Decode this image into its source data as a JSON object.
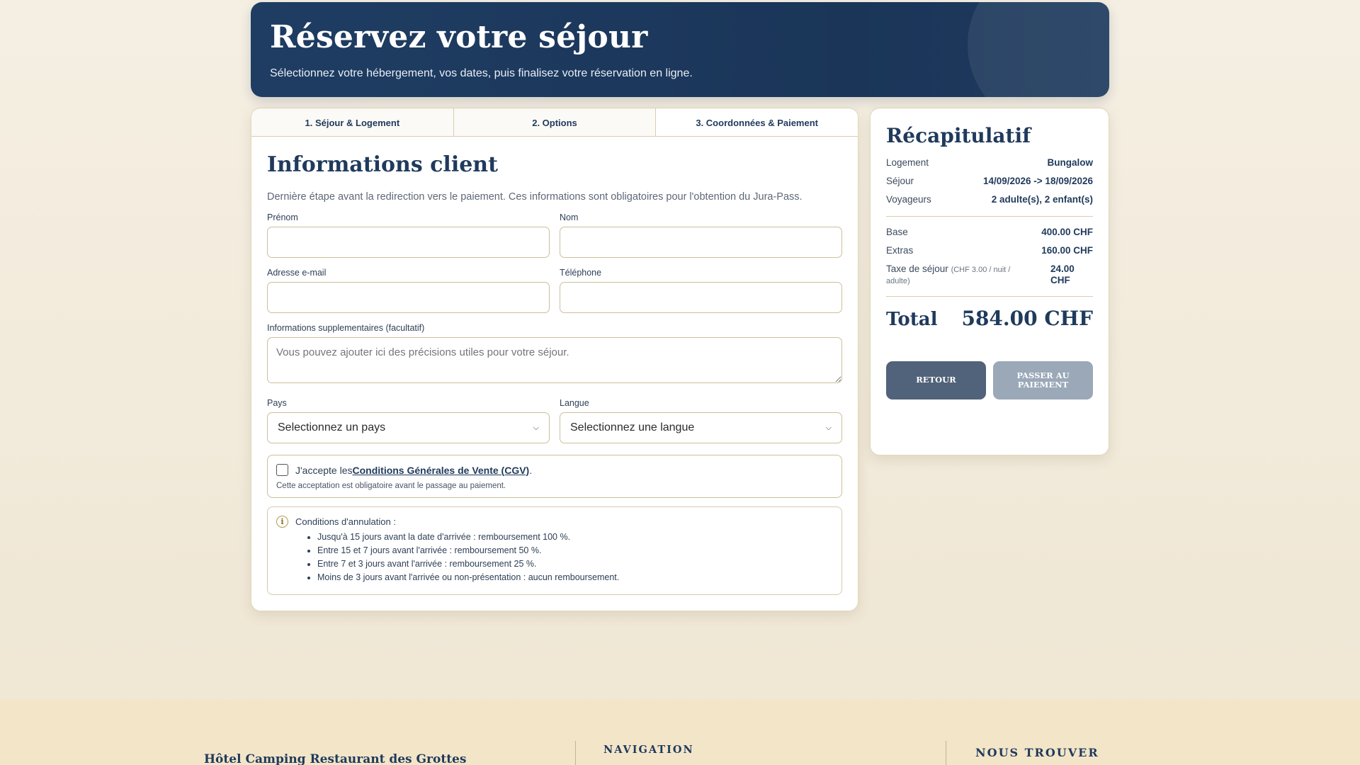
{
  "hero": {
    "title": "Réservez votre séjour",
    "subtitle": "Sélectionnez votre hébergement, vos dates, puis finalisez votre réservation en ligne."
  },
  "tabs": [
    {
      "label": "1. Séjour & Logement"
    },
    {
      "label": "2. Options"
    },
    {
      "label": "3. Coordonnées & Paiement"
    }
  ],
  "form": {
    "title": "Informations client",
    "lead": "Dernière étape avant la redirection vers le paiement. Ces informations sont obligatoires pour l'obtention du Jura-Pass.",
    "firstname_label": "Prénom",
    "lastname_label": "Nom",
    "email_label": "Adresse e-mail",
    "phone_label": "Téléphone",
    "notes_label": "Informations supplementaires (facultatif)",
    "notes_placeholder": "Vous pouvez ajouter ici des précisions utiles pour votre séjour.",
    "country_label": "Pays",
    "country_value": "Selectionnez un pays",
    "language_label": "Langue",
    "language_value": "Selectionnez une langue"
  },
  "cgv": {
    "prefix": "J'accepte les ",
    "link": "Conditions Générales de Vente (CGV)",
    "suffix": ".",
    "note": "Cette acceptation est obligatoire avant le passage au paiement."
  },
  "cancellation": {
    "title": "Conditions d'annulation :",
    "items": [
      "Jusqu'à 15 jours avant la date d'arrivée : remboursement 100 %.",
      "Entre 15 et 7 jours avant l'arrivée : remboursement 50 %.",
      "Entre 7 et 3 jours avant l'arrivée : remboursement 25 %.",
      "Moins de 3 jours avant l'arrivée ou non-présentation : aucun remboursement."
    ]
  },
  "summary": {
    "title": "Récapitulatif",
    "rows": [
      {
        "label": "Logement",
        "value": "Bungalow"
      },
      {
        "label": "Séjour",
        "value": "14/09/2026 -> 18/09/2026"
      },
      {
        "label": "Voyageurs",
        "value": "2 adulte(s), 2 enfant(s)"
      }
    ],
    "prices": [
      {
        "label": "Base",
        "value": "400.00 CHF"
      },
      {
        "label": "Extras",
        "value": "160.00 CHF"
      }
    ],
    "tax_label": "Taxe de séjour",
    "tax_note": "(CHF 3.00 / nuit / adulte)",
    "tax_value": "24.00 CHF",
    "total_label": "Total",
    "total_value": "584.00 CHF",
    "back_label": "Retour",
    "pay_label": "Passer au paiement"
  },
  "footer": {
    "brand": "Hôtel Camping Restaurant des Grottes",
    "nav_title": "NAVIGATION",
    "find_title": "NOUS TROUVER"
  }
}
